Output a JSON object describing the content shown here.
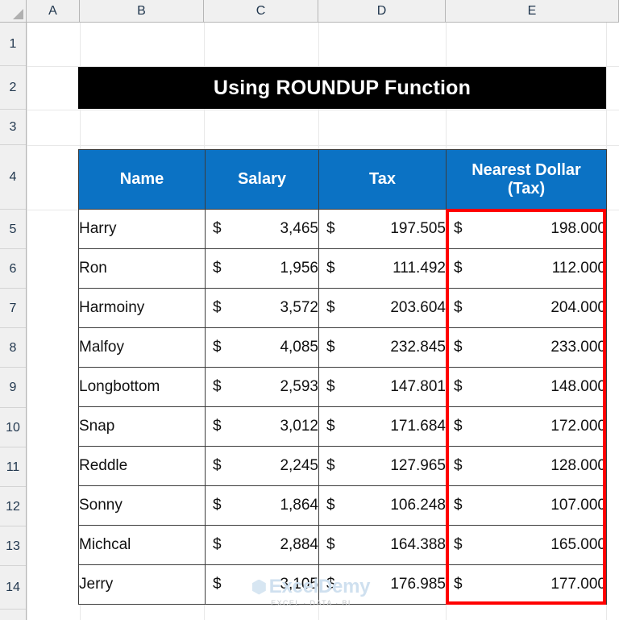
{
  "app": {
    "type": "spreadsheet",
    "column_headers": [
      "A",
      "B",
      "C",
      "D",
      "E"
    ],
    "row_headers": [
      "1",
      "2",
      "3",
      "4",
      "5",
      "6",
      "7",
      "8",
      "9",
      "10",
      "11",
      "12",
      "13",
      "14"
    ],
    "select_all_icon": "select-all-triangle-icon"
  },
  "title": {
    "text": "Using ROUNDUP Function",
    "background_color": "#000000",
    "text_color": "#FFFFFF"
  },
  "table": {
    "header_background_color": "#0B72C4",
    "header_text_color": "#FFFFFF",
    "border_color": "#3C3C3C",
    "columns": [
      {
        "key": "name",
        "label": "Name",
        "align": "left"
      },
      {
        "key": "salary",
        "label": "Salary",
        "align": "right"
      },
      {
        "key": "tax",
        "label": "Tax",
        "align": "right"
      },
      {
        "key": "rounded",
        "label": "Nearest Dollar (Tax)",
        "label_line1": "Nearest Dollar",
        "label_line2": "(Tax)",
        "align": "right"
      }
    ],
    "currency_symbol": "$",
    "rows": [
      {
        "name": "Harry",
        "salary": "3,465",
        "tax": "197.505",
        "rounded": "198.000"
      },
      {
        "name": "Ron",
        "salary": "1,956",
        "tax": "111.492",
        "rounded": "112.000"
      },
      {
        "name": "Harmoiny",
        "salary": "3,572",
        "tax": "203.604",
        "rounded": "204.000"
      },
      {
        "name": "Malfoy",
        "salary": "4,085",
        "tax": "232.845",
        "rounded": "233.000"
      },
      {
        "name": "Longbottom",
        "salary": "2,593",
        "tax": "147.801",
        "rounded": "148.000"
      },
      {
        "name": "Snap",
        "salary": "3,012",
        "tax": "171.684",
        "rounded": "172.000"
      },
      {
        "name": "Reddle",
        "salary": "2,245",
        "tax": "127.965",
        "rounded": "128.000"
      },
      {
        "name": "Sonny",
        "salary": "1,864",
        "tax": "106.248",
        "rounded": "107.000"
      },
      {
        "name": "Michcal",
        "salary": "2,884",
        "tax": "164.388",
        "rounded": "165.000"
      },
      {
        "name": "Jerry",
        "salary": "3,105",
        "tax": "176.985",
        "rounded": "177.000"
      }
    ]
  },
  "highlight": {
    "target_column": "Nearest Dollar (Tax)",
    "border_color": "#FF0000"
  },
  "watermark": {
    "brand": "ExcelDemy",
    "tagline": "EXCEL · DATA · BI"
  }
}
